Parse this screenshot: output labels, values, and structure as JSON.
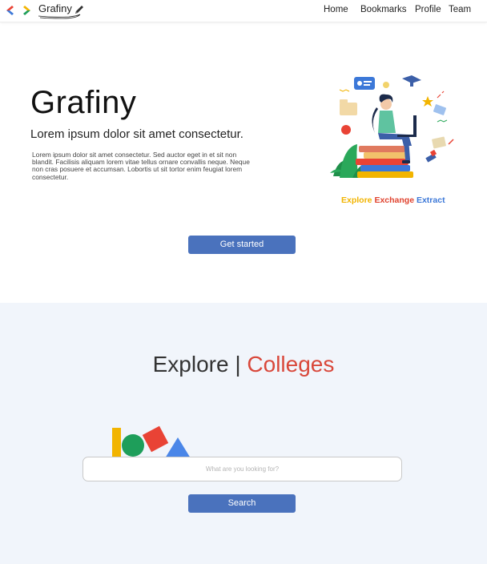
{
  "nav": {
    "brand": "Grafiny",
    "links": [
      "Home",
      "Bookmarks",
      "Profile",
      "Team"
    ]
  },
  "hero": {
    "title": "Grafiny",
    "subtitle": "Lorem ipsum dolor sit amet consectetur.",
    "paragraph": "Lorem ipsum dolor sit amet consectetur. Sed auctor eget in et sit non blandit. Facilisis aliquam lorem vitae tellus ornare convallis neque. Neque non cras posuere et accumsan. Lobortis ut sit tortor enim feugiat lorem consectetur.",
    "tagline": {
      "w1": "Explore",
      "w2": "Exchange",
      "w3": "Extract"
    },
    "cta_label": "Get started"
  },
  "explore": {
    "title_left": "Explore",
    "separator": "|",
    "title_right": "Colleges",
    "search_placeholder": "What are you looking for?",
    "search_label": "Search"
  },
  "colors": {
    "accent_blue": "#4a72bd",
    "red": "#d9483b",
    "yellow": "#f2b400",
    "green": "#1e9e5a",
    "section_bg": "#f1f5fb"
  }
}
